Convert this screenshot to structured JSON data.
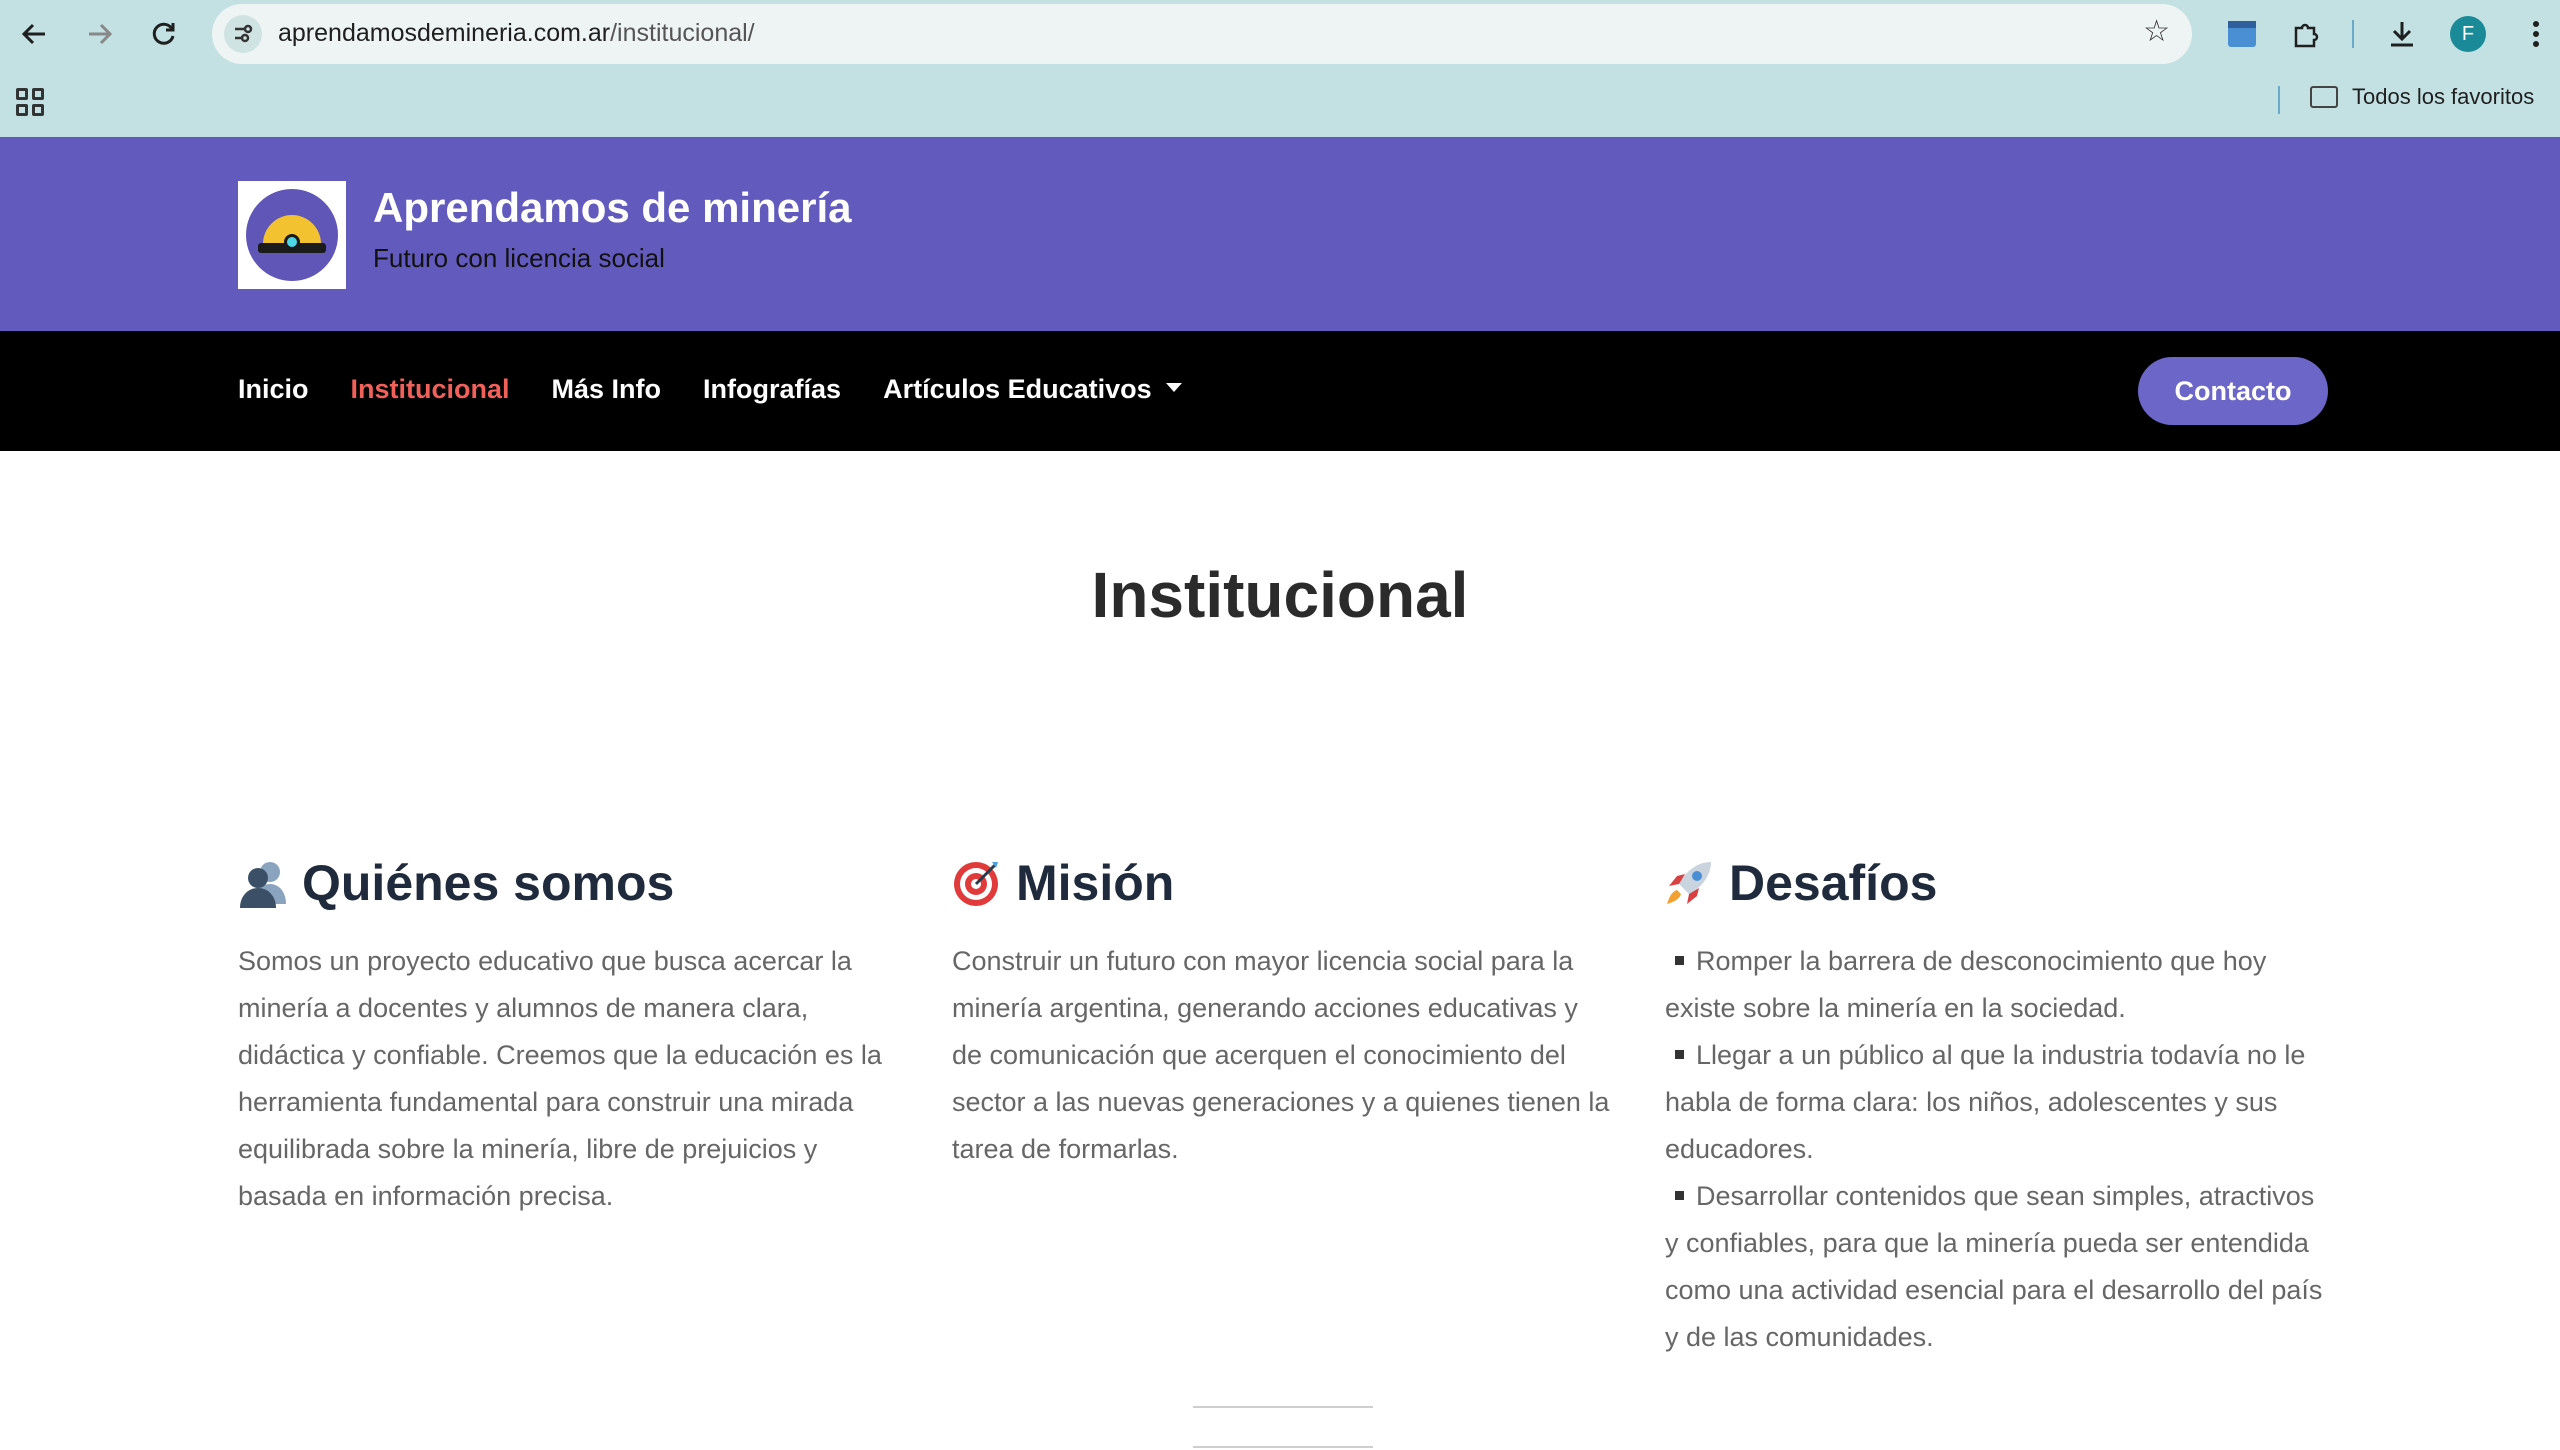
{
  "browser": {
    "url_domain": "aprendamosdemineria.com.ar",
    "url_path": "/institucional/",
    "bookmarks_folder": "Todos los favoritos",
    "profile_initial": "F"
  },
  "site": {
    "title": "Aprendamos de minería",
    "tagline": "Futuro con licencia social"
  },
  "nav": {
    "items": [
      {
        "label": "Inicio"
      },
      {
        "label": "Institucional"
      },
      {
        "label": "Más Info"
      },
      {
        "label": "Infografías"
      },
      {
        "label": "Artículos Educativos"
      }
    ],
    "contact_label": "Contacto"
  },
  "page": {
    "title": "Institucional"
  },
  "sections": {
    "about": {
      "title": "Quiénes somos",
      "text": "Somos un proyecto educativo que busca acercar la minería a docentes y alumnos de manera clara, didáctica y confiable. Creemos que la educación es la herramienta fundamental para construir una mirada equilibrada sobre la minería, libre de prejuicios y basada en información precisa."
    },
    "mission": {
      "title": "Misión",
      "text": "Construir un futuro con mayor licencia social para la minería argentina, generando acciones educativas y de comunicación que acerquen el conocimiento del sector a las nuevas generaciones y a quienes tienen la tarea de formarlas."
    },
    "challenges": {
      "title": "Desafíos",
      "items": [
        "Romper la barrera de desconocimiento que hoy existe sobre la minería en la sociedad.",
        "Llegar a un público al que la industria todavía no le habla de forma clara: los niños, adolescentes y sus educadores.",
        "Desarrollar contenidos que sean simples, atractivos y confiables, para que la minería pueda ser entendida como una actividad esencial para el desarrollo del país y de las comunidades."
      ]
    }
  },
  "colors": {
    "header_bg": "#625bbd",
    "nav_bg": "#000000",
    "active_link": "#f2605a",
    "contact_btn": "#6c66c9"
  }
}
